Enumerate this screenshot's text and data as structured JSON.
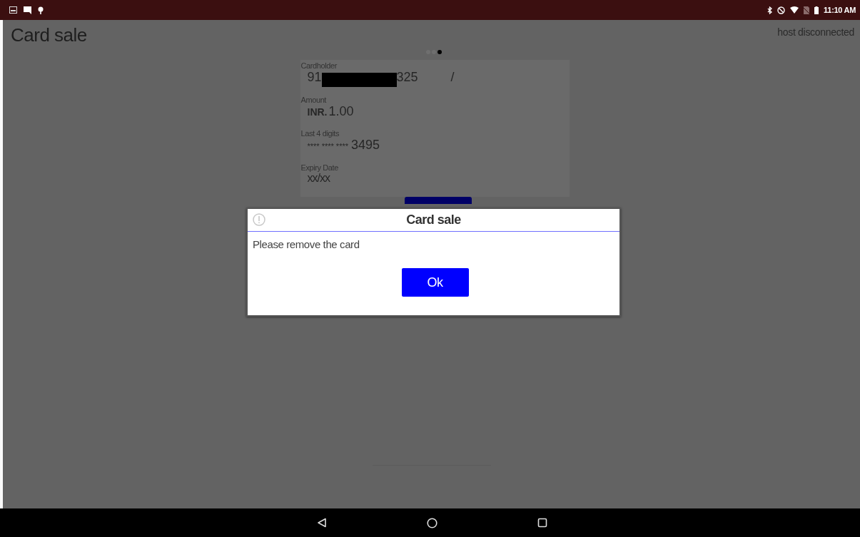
{
  "status_bar": {
    "time": "11:10 AM"
  },
  "title": "Card sale",
  "connection": "host disconnected",
  "pages": [
    {
      "selected": false
    },
    {
      "selected": false
    },
    {
      "selected": true
    }
  ],
  "fields": [
    {
      "kind": "redacted",
      "label": "Cardholder",
      "prefix": "91",
      "suffix": "325",
      "extra": "/"
    },
    {
      "kind": "amount",
      "label": "Amount",
      "currency": "INR.",
      "value": "1.00"
    },
    {
      "kind": "plain",
      "label": "Last 4 digits",
      "mask": "**** **** ****",
      "value": "3495"
    },
    {
      "kind": "plain",
      "label": "Expiry Date",
      "value": "xx/xx"
    }
  ],
  "dialog": {
    "title": "Card sale",
    "message": "Please remove the card",
    "button": "Ok"
  }
}
